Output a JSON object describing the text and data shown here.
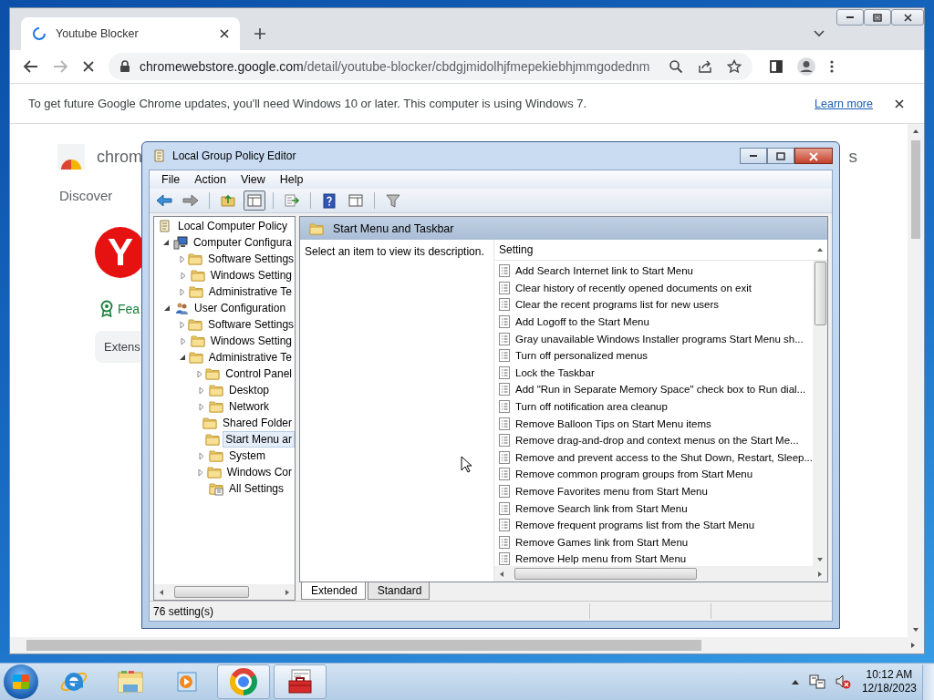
{
  "browser": {
    "tab": {
      "title": "Youtube Blocker"
    },
    "url": {
      "host": "chromewebstore.google.com",
      "path": "/detail/youtube-blocker/cbdgjmidolhjfmepekiebhjmmgodednm"
    },
    "infobar": {
      "text": "To get future Google Chrome updates, you'll need Windows 10 or later. This computer is using Windows 7.",
      "link": "Learn more"
    },
    "page": {
      "brand": "chrom",
      "corner_text": "s",
      "nav": "Discover",
      "logo_letter": "Y",
      "featured": "Fea",
      "chip": "Extens"
    }
  },
  "gpe": {
    "title": "Local Group Policy Editor",
    "menu": [
      "File",
      "Action",
      "View",
      "Help"
    ],
    "toolbar": [
      [
        {
          "kind": "back",
          "pressed": false
        },
        {
          "kind": "forward",
          "pressed": false
        }
      ],
      [
        {
          "kind": "up",
          "pressed": false
        },
        {
          "kind": "tree",
          "pressed": true
        }
      ],
      [
        {
          "kind": "export",
          "pressed": false
        }
      ],
      [
        {
          "kind": "help",
          "pressed": false
        },
        {
          "kind": "pane",
          "pressed": false
        }
      ],
      [
        {
          "kind": "filter",
          "pressed": false
        }
      ]
    ],
    "tree": [
      {
        "label": "Local Computer Policy",
        "kind": "policy",
        "selected": false,
        "children": [
          {
            "label": "Computer Configura",
            "kind": "computer",
            "expandable": true,
            "expanded": true,
            "selected": false,
            "children": [
              {
                "label": "Software Settings",
                "kind": "folder",
                "expandable": true,
                "expanded": false,
                "selected": false
              },
              {
                "label": "Windows Setting",
                "kind": "folder",
                "expandable": true,
                "expanded": false,
                "selected": false
              },
              {
                "label": "Administrative Te",
                "kind": "folder",
                "expandable": true,
                "expanded": false,
                "selected": false
              }
            ]
          },
          {
            "label": "User Configuration",
            "kind": "user",
            "expandable": true,
            "expanded": true,
            "selected": false,
            "children": [
              {
                "label": "Software Settings",
                "kind": "folder",
                "expandable": true,
                "expanded": false,
                "selected": false
              },
              {
                "label": "Windows Setting",
                "kind": "folder",
                "expandable": true,
                "expanded": false,
                "selected": false
              },
              {
                "label": "Administrative Te",
                "kind": "folder",
                "expandable": true,
                "expanded": true,
                "selected": false,
                "children": [
                  {
                    "label": "Control Panel",
                    "kind": "folder",
                    "expandable": true,
                    "expanded": false,
                    "selected": false
                  },
                  {
                    "label": "Desktop",
                    "kind": "folder",
                    "expandable": true,
                    "expanded": false,
                    "selected": false
                  },
                  {
                    "label": "Network",
                    "kind": "folder",
                    "expandable": true,
                    "expanded": false,
                    "selected": false
                  },
                  {
                    "label": "Shared Folder",
                    "kind": "folder",
                    "expandable": false,
                    "selected": false
                  },
                  {
                    "label": "Start Menu ar",
                    "kind": "folder",
                    "expandable": false,
                    "selected": true
                  },
                  {
                    "label": "System",
                    "kind": "folder",
                    "expandable": true,
                    "expanded": false,
                    "selected": false
                  },
                  {
                    "label": "Windows Cor",
                    "kind": "folder",
                    "expandable": true,
                    "expanded": false,
                    "selected": false
                  },
                  {
                    "label": "All Settings",
                    "kind": "all",
                    "expandable": false,
                    "selected": false
                  }
                ]
              }
            ]
          }
        ]
      }
    ],
    "header": "Start Menu and Taskbar",
    "description": "Select an item to view its description.",
    "column": "Setting",
    "settings": [
      "Add Search Internet link to Start Menu",
      "Clear history of recently opened documents on exit",
      "Clear the recent programs list for new users",
      "Add Logoff to the Start Menu",
      "Gray unavailable Windows Installer programs Start Menu sh...",
      "Turn off personalized menus",
      "Lock the Taskbar",
      "Add \"Run in Separate Memory Space\" check box to Run dial...",
      "Turn off notification area cleanup",
      "Remove Balloon Tips on Start Menu items",
      "Remove drag-and-drop and context menus on the Start Me...",
      "Remove and prevent access to the Shut Down, Restart, Sleep...",
      "Remove common program groups from Start Menu",
      "Remove Favorites menu from Start Menu",
      "Remove Search link from Start Menu",
      "Remove frequent programs list from the Start Menu",
      "Remove Games link from Start Menu",
      "Remove Help menu from Start Menu"
    ],
    "tabs": [
      {
        "label": "Extended",
        "selected": true
      },
      {
        "label": "Standard",
        "selected": false
      }
    ],
    "status": "76 setting(s)"
  },
  "taskbar": {
    "apps": [
      {
        "kind": "ie",
        "running": false
      },
      {
        "kind": "explorer",
        "running": false
      },
      {
        "kind": "media",
        "running": false
      },
      {
        "kind": "chrome",
        "running": true
      },
      {
        "kind": "toolbox",
        "running": true
      }
    ],
    "clock": {
      "time": "10:12 AM",
      "date": "12/18/2023"
    }
  }
}
